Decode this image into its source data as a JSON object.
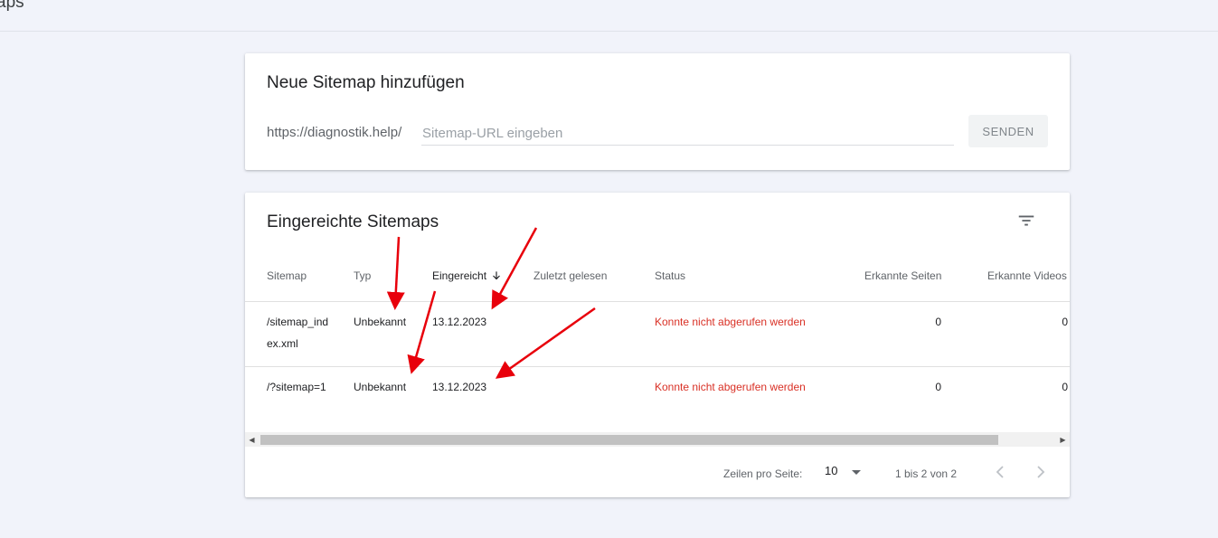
{
  "page": {
    "title": "aps"
  },
  "add_sitemap": {
    "title": "Neue Sitemap hinzufügen",
    "url_prefix": "https://diagnostik.help/",
    "input_placeholder": "Sitemap-URL eingeben",
    "input_value": "",
    "send_label": "SENDEN"
  },
  "submitted": {
    "title": "Eingereichte Sitemaps",
    "filter_icon": "filter-icon",
    "columns": [
      "Sitemap",
      "Typ",
      "Eingereicht",
      "Zuletzt gelesen",
      "Status",
      "Erkannte Seiten",
      "Erkannte Videos"
    ],
    "sort_icon": "arrow-down-icon",
    "rows": [
      {
        "sitemap": "/sitemap_index.xml",
        "type": "Unbekannt",
        "submitted": "13.12.2023",
        "last_read": "",
        "status": "Konnte nicht abgerufen werden",
        "pages": "0",
        "videos": "0"
      },
      {
        "sitemap": "/?sitemap=1",
        "type": "Unbekannt",
        "submitted": "13.12.2023",
        "last_read": "",
        "status": "Konnte nicht abgerufen werden",
        "pages": "0",
        "videos": "0"
      }
    ]
  },
  "pagination": {
    "rows_per_page_label": "Zeilen pro Seite:",
    "rows_per_page_value": "10",
    "range_label": "1 bis 2 von 2"
  },
  "colors": {
    "background": "#f1f3fa",
    "status_error": "#d93025",
    "annotation_arrow": "#e8000b"
  }
}
